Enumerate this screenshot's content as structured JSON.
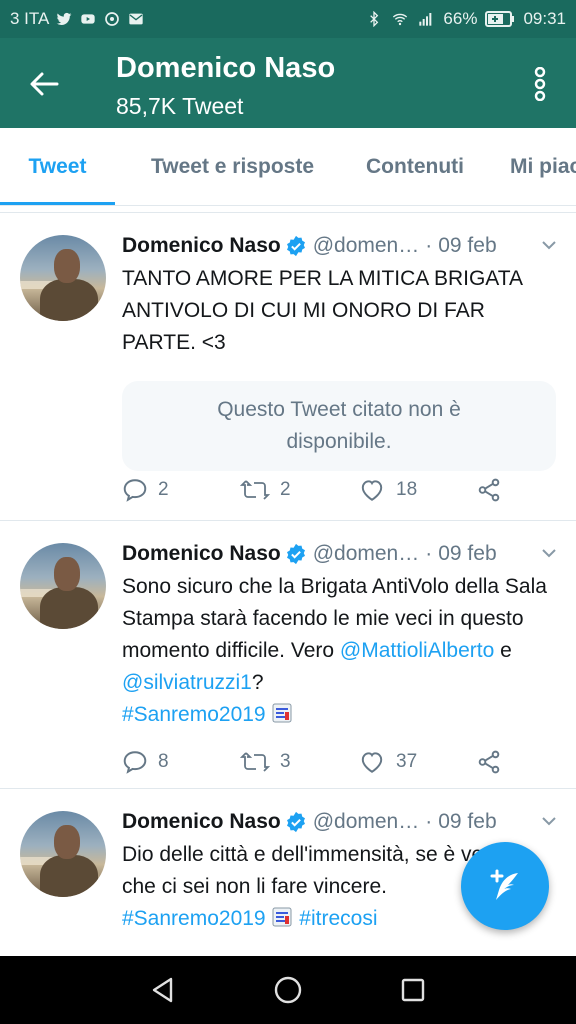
{
  "status_bar": {
    "carrier": "3 ITA",
    "battery": "66%",
    "time": "09:31",
    "icons": [
      "twitter-icon",
      "youtube-icon",
      "whatsapp-icon",
      "mail-icon",
      "bluetooth-icon",
      "wifi-icon",
      "signal-icon",
      "battery-icon"
    ]
  },
  "header": {
    "title": "Domenico Naso",
    "subtitle": "85,7K Tweet",
    "bg_color": "#1f7466"
  },
  "tabs": [
    {
      "label": "Tweet",
      "active": true
    },
    {
      "label": "Tweet e risposte",
      "active": false
    },
    {
      "label": "Contenuti",
      "active": false
    },
    {
      "label": "Mi piace",
      "active": false
    }
  ],
  "accent_color": "#1da1f2",
  "tweets": [
    {
      "name": "Domenico Naso",
      "handle": "@domen…",
      "dot": "·",
      "date": "09 feb",
      "text": "TANTO AMORE PER LA MITICA BRIGATA ANTIVOLO DI CUI MI ONORO DI FAR PARTE. <3",
      "quote": "Questo Tweet citato non è disponibile.",
      "replies": "2",
      "retweets": "2",
      "likes": "18"
    },
    {
      "name": "Domenico Naso",
      "handle": "@domen…",
      "dot": "·",
      "date": "09 feb",
      "text_prefix": "Sono sicuro che la Brigata AntiVolo della Sala Stampa starà facendo le mie veci in questo momento difficile. Vero ",
      "mention1": "@MattioliAlberto",
      "text_and": " e ",
      "mention2": "@silviatruzzi1",
      "text_q": "?",
      "hashtag": "#Sanremo2019",
      "replies": "8",
      "retweets": "3",
      "likes": "37"
    },
    {
      "name": "Domenico Naso",
      "handle": "@domen…",
      "dot": "·",
      "date": "09 feb",
      "text_line1": "Dio delle città e dell'immensità, se è vero",
      "text_line2": "che ci sei non li fare vincere.",
      "hashtag1": "#Sanremo2019",
      "hashtag2": "#itrecosi"
    }
  ]
}
